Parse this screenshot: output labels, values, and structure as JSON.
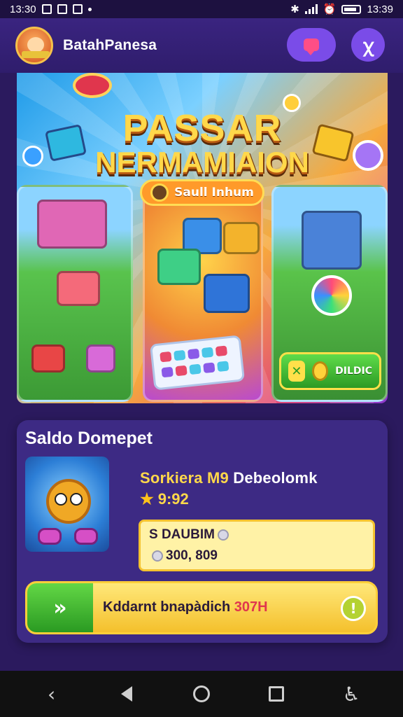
{
  "status_bar": {
    "time_left": "13:30",
    "time_right": "13:39"
  },
  "header": {
    "app_title": "BatahPanesa"
  },
  "banner": {
    "title_line1": "PASSAR",
    "title_line2": "NERMAMIAION",
    "pill_label": "Saull  Inhum",
    "green_button_label": "DILDIC"
  },
  "wallet": {
    "title": "Saldo Domepet",
    "game_name_part1": "Sorkiera M9",
    "game_name_part2": "Debeolomk",
    "rating": "9:92",
    "balance_label": "S DAUBIM",
    "balance_value": "300, 809",
    "cta_label_main": "Kddarnt bnapàdich",
    "cta_label_accent": "307H",
    "cta_info_glyph": "!",
    "cta_left_glyph": "»"
  },
  "colors": {
    "background": "#2b1a5e",
    "header": "#3a2480",
    "accent_purple": "#7a4ce8",
    "gold": "#ffd84a",
    "green": "#2a9a22"
  },
  "icons": [
    "avatar",
    "chat-icon",
    "user-icon",
    "back-icon",
    "home-icon",
    "recents-icon",
    "accessibility-icon"
  ]
}
